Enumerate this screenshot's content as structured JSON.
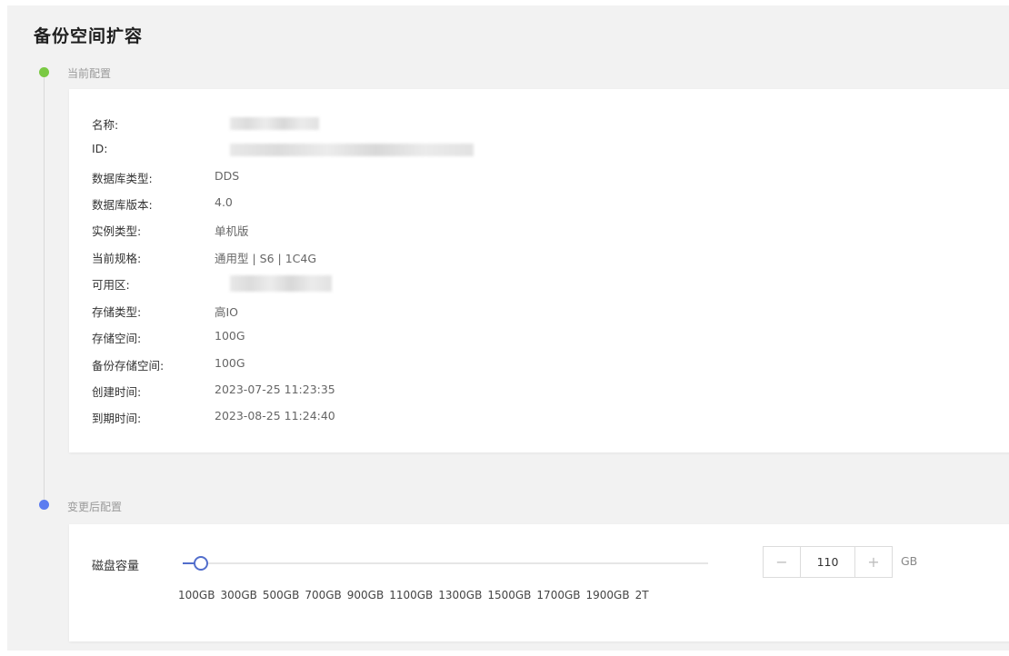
{
  "page": {
    "title": "备份空间扩容"
  },
  "steps": {
    "current_label": "当前配置",
    "after_label": "变更后配置",
    "current_color": "#7ac943",
    "after_color": "#5b7cf0"
  },
  "current_config": {
    "rows": [
      {
        "key": "名称:",
        "value": ""
      },
      {
        "key": "ID:",
        "value": ""
      },
      {
        "key": "数据库类型:",
        "value": "DDS"
      },
      {
        "key": "数据库版本:",
        "value": "4.0"
      },
      {
        "key": "实例类型:",
        "value": "单机版"
      },
      {
        "key": "当前规格:",
        "value": "通用型 | S6 | 1C4G"
      },
      {
        "key": "可用区:",
        "value": ""
      },
      {
        "key": "存储类型:",
        "value": "高IO"
      },
      {
        "key": "存储空间:",
        "value": "100G"
      },
      {
        "key": "备份存储空间:",
        "value": "100G"
      },
      {
        "key": "创建时间:",
        "value": "2023-07-25 11:23:35"
      },
      {
        "key": "到期时间:",
        "value": "2023-08-25 11:24:40"
      }
    ]
  },
  "after_config": {
    "disk_label": "磁盘容量",
    "slider": {
      "min": 100,
      "max": 2048,
      "value": 110,
      "accent_color": "#526ecc",
      "ticks": [
        "100GB",
        "300GB",
        "500GB",
        "700GB",
        "900GB",
        "1100GB",
        "1300GB",
        "1500GB",
        "1700GB",
        "1900GB",
        "2T"
      ]
    },
    "stepper": {
      "minus": "−",
      "value": "110",
      "plus": "+"
    },
    "unit": "GB"
  }
}
